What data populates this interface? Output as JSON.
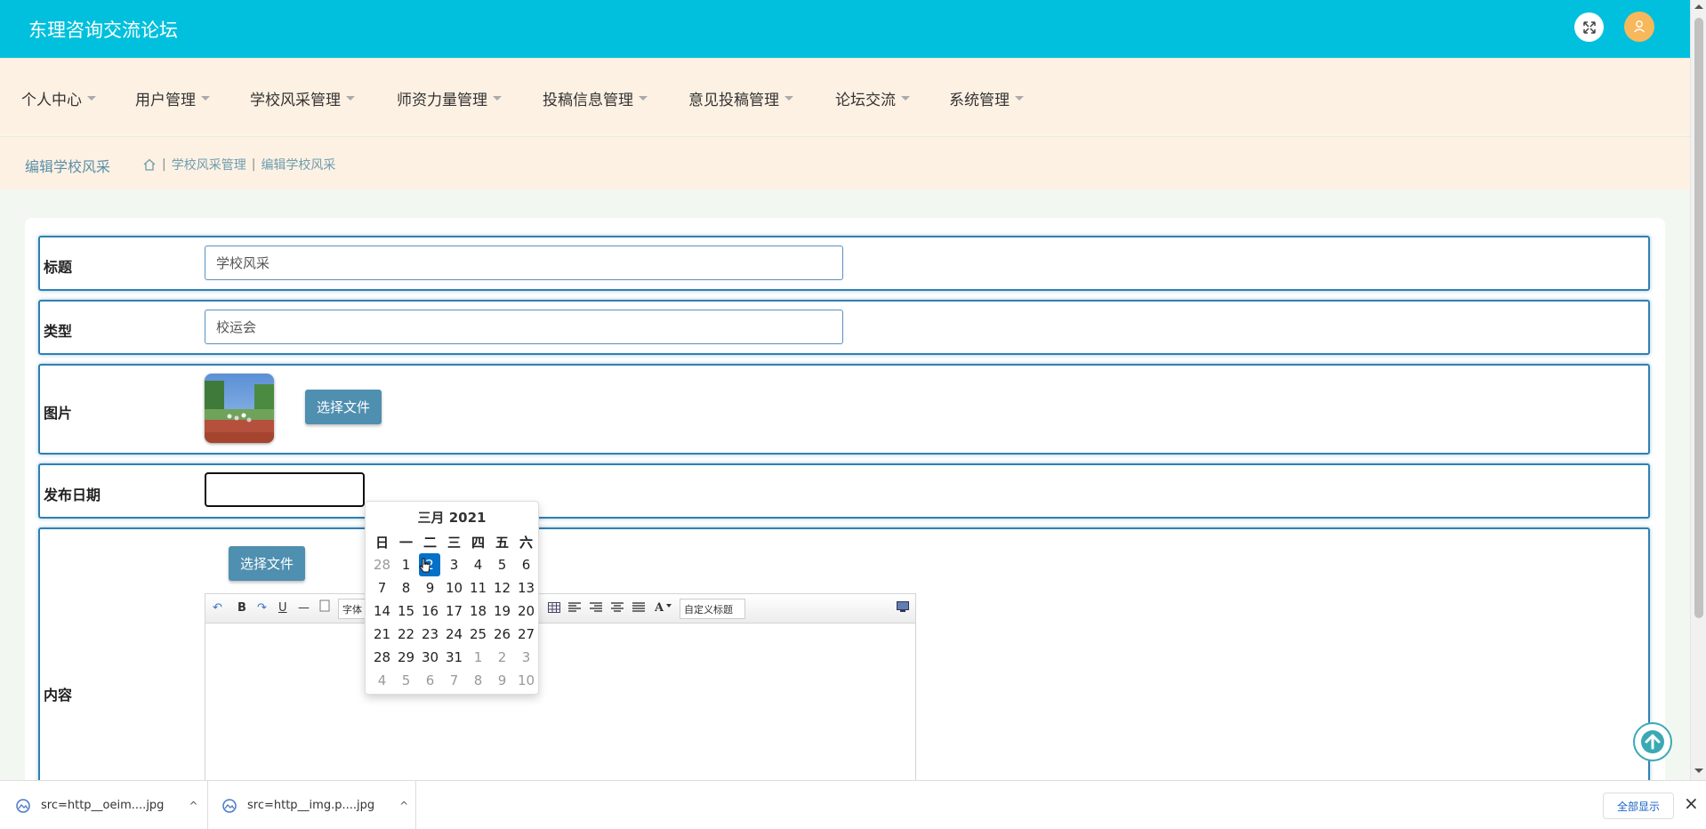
{
  "app": {
    "title": "东理咨询交流论坛"
  },
  "nav": {
    "items": [
      {
        "label": "个人中心"
      },
      {
        "label": "用户管理"
      },
      {
        "label": "学校风采管理"
      },
      {
        "label": "师资力量管理"
      },
      {
        "label": "投稿信息管理"
      },
      {
        "label": "意见投稿管理"
      },
      {
        "label": "论坛交流"
      },
      {
        "label": "系统管理"
      }
    ]
  },
  "breadcrumb": {
    "page_title": "编辑学校风采",
    "items": [
      "学校风采管理",
      "编辑学校风采"
    ],
    "separator": "|"
  },
  "form": {
    "title": {
      "label": "标题",
      "value": "学校风采"
    },
    "type": {
      "label": "类型",
      "value": "校运会"
    },
    "image": {
      "label": "图片",
      "button": "选择文件"
    },
    "date": {
      "label": "发布日期",
      "value": ""
    },
    "content": {
      "label": "内容",
      "button": "选择文件",
      "toolbar": {
        "bold": "B",
        "underline": "U",
        "font": "字体",
        "font_color": "A",
        "custom_heading": "自定义标题"
      }
    }
  },
  "datepicker": {
    "header": "三月 2021",
    "weekdays": [
      "日",
      "一",
      "二",
      "三",
      "四",
      "五",
      "六"
    ],
    "weeks": [
      [
        "28",
        "1",
        "2",
        "3",
        "4",
        "5",
        "6"
      ],
      [
        "7",
        "8",
        "9",
        "10",
        "11",
        "12",
        "13"
      ],
      [
        "14",
        "15",
        "16",
        "17",
        "18",
        "19",
        "20"
      ],
      [
        "21",
        "22",
        "23",
        "24",
        "25",
        "26",
        "27"
      ],
      [
        "28",
        "29",
        "30",
        "31",
        "1",
        "2",
        "3"
      ],
      [
        "4",
        "5",
        "6",
        "7",
        "8",
        "9",
        "10"
      ]
    ],
    "selected": "2"
  },
  "downloads": {
    "items": [
      {
        "name": "src=http__oeim....jpg"
      },
      {
        "name": "src=http__img.p....jpg"
      }
    ],
    "show_all": "全部显示"
  },
  "colors": {
    "header": "#00c0dd",
    "nav_bg": "#fdf1e3",
    "accent_border": "#2f80b2",
    "button": "#4f8fb0",
    "selected_day": "#0570c8"
  }
}
